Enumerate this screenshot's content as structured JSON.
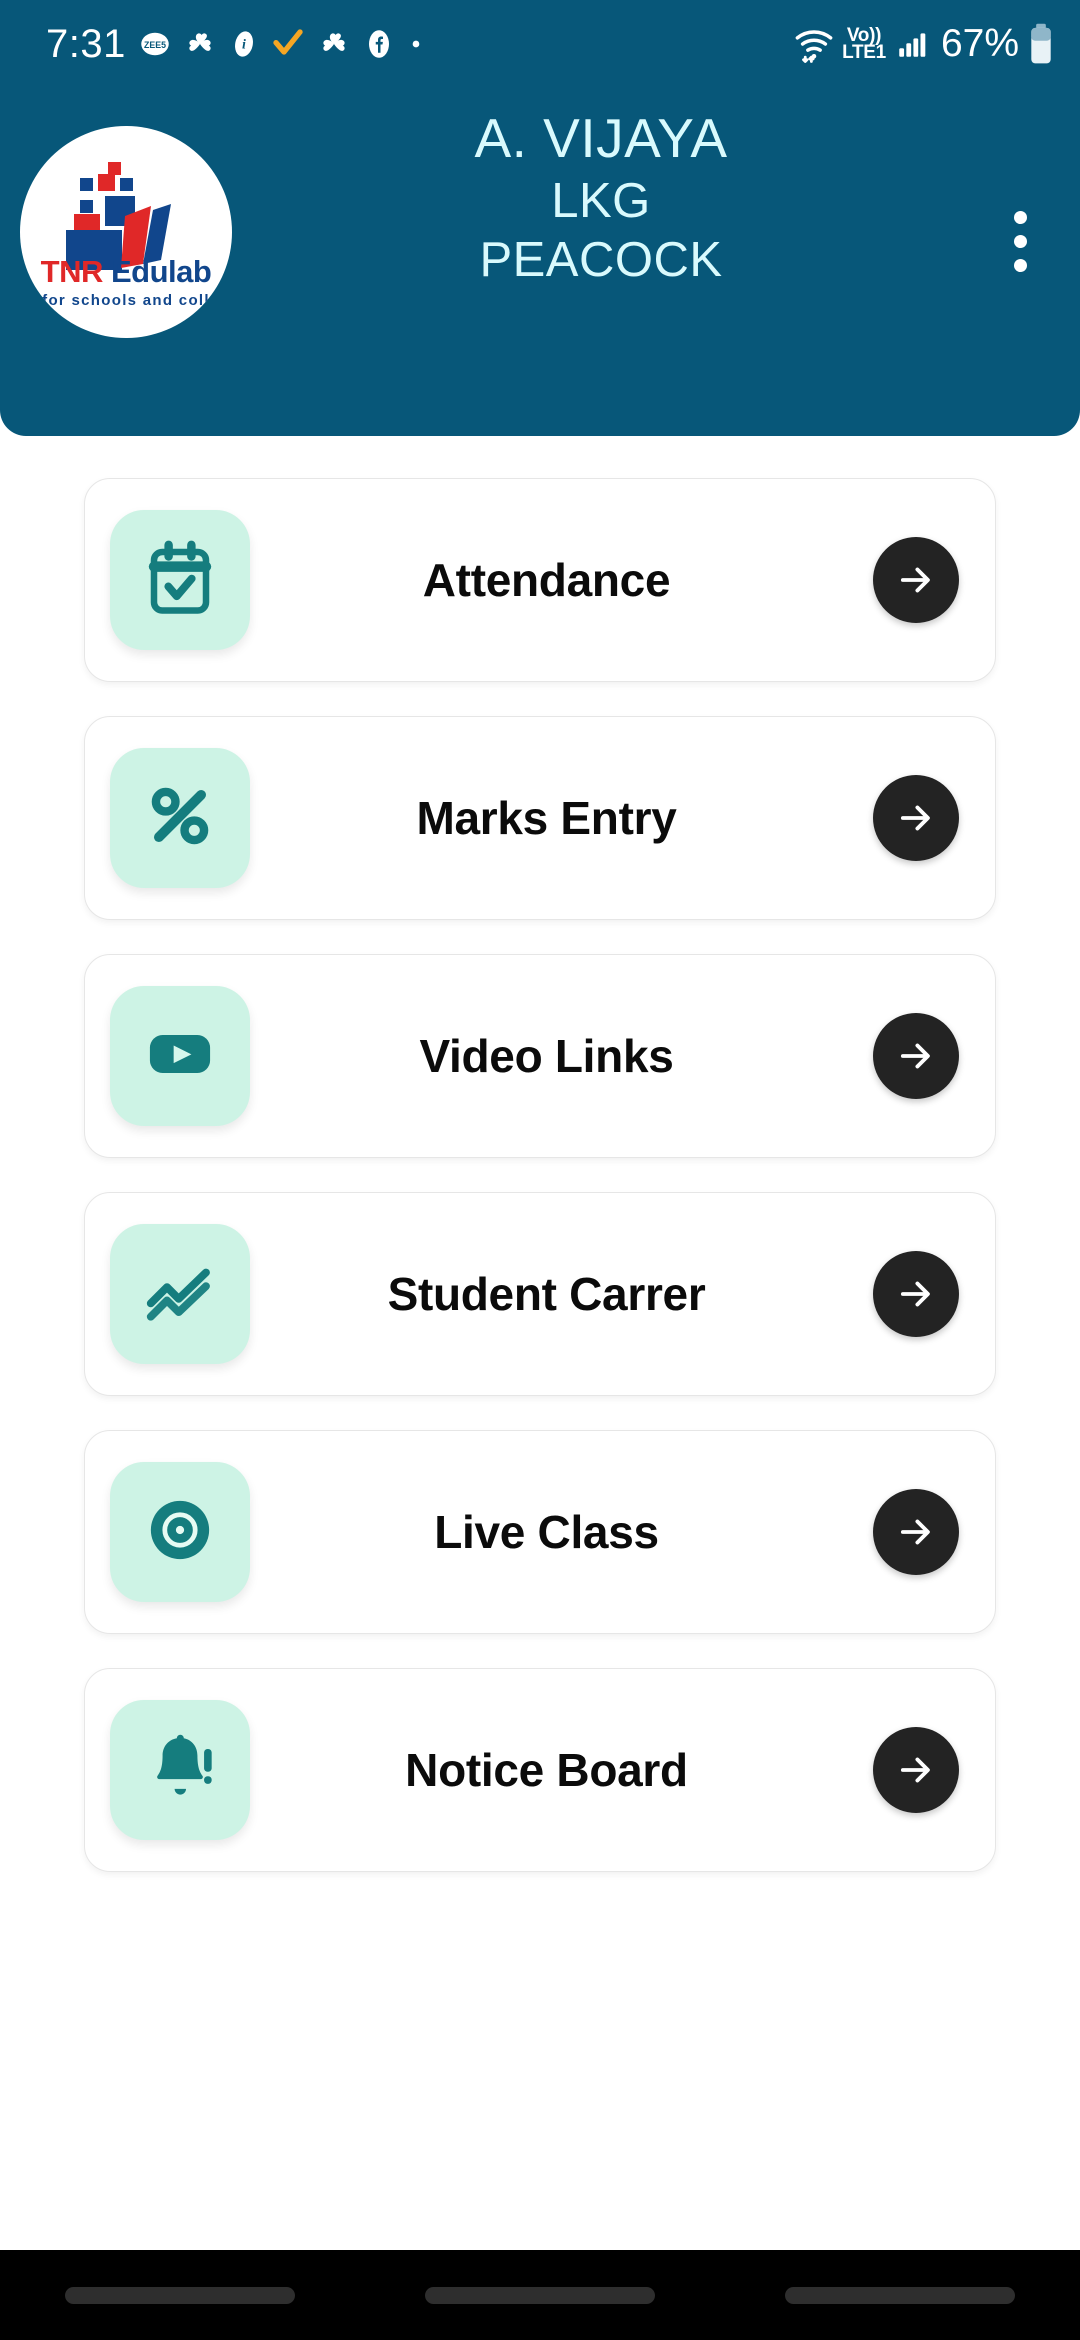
{
  "status_bar": {
    "time": "7:31",
    "left_icons": [
      "zee5-icon",
      "flower-app-icon",
      "info-app-icon",
      "orange-check-icon",
      "flower-app-icon-2",
      "facebook-icon",
      "more-dot-icon"
    ],
    "wifi_icon": "wifi-icon",
    "volte_top": "Vo))",
    "volte_bottom": "LTE1",
    "signal_icon": "cellular-signal-icon",
    "battery_percent": "67%",
    "battery_icon": "battery-icon"
  },
  "header": {
    "background_color": "#075779",
    "logo": {
      "name_part1": "TNR",
      "name_part2": "Edulab",
      "tagline": "for schools and coll",
      "red": "#e02828",
      "blue": "#11468c"
    },
    "title": "A. VIJAYA",
    "class": "LKG",
    "section": "PEACOCK",
    "title_color": "#d9fafd",
    "menu_icon": "kebab-menu-icon"
  },
  "theme": {
    "tile_background": "#cdf3e5",
    "icon_color": "#157d7e",
    "arrow_button_color": "#232323",
    "card_background": "#ffffff"
  },
  "menu": {
    "items": [
      {
        "label": "Attendance",
        "icon": "calendar-check-icon",
        "arrow": "arrow-right-icon"
      },
      {
        "label": "Marks Entry",
        "icon": "percent-icon",
        "arrow": "arrow-right-icon"
      },
      {
        "label": "Video Links",
        "icon": "video-play-icon",
        "arrow": "arrow-right-icon"
      },
      {
        "label": "Student Carrer",
        "icon": "line-chart-icon",
        "arrow": "arrow-right-icon"
      },
      {
        "label": "Live Class",
        "icon": "broadcast-icon",
        "arrow": "arrow-right-icon"
      },
      {
        "label": "Notice Board",
        "icon": "bell-alert-icon",
        "arrow": "arrow-right-icon"
      }
    ]
  },
  "nav_bar": {
    "pills": [
      "recents-pill",
      "home-pill",
      "back-pill"
    ]
  }
}
